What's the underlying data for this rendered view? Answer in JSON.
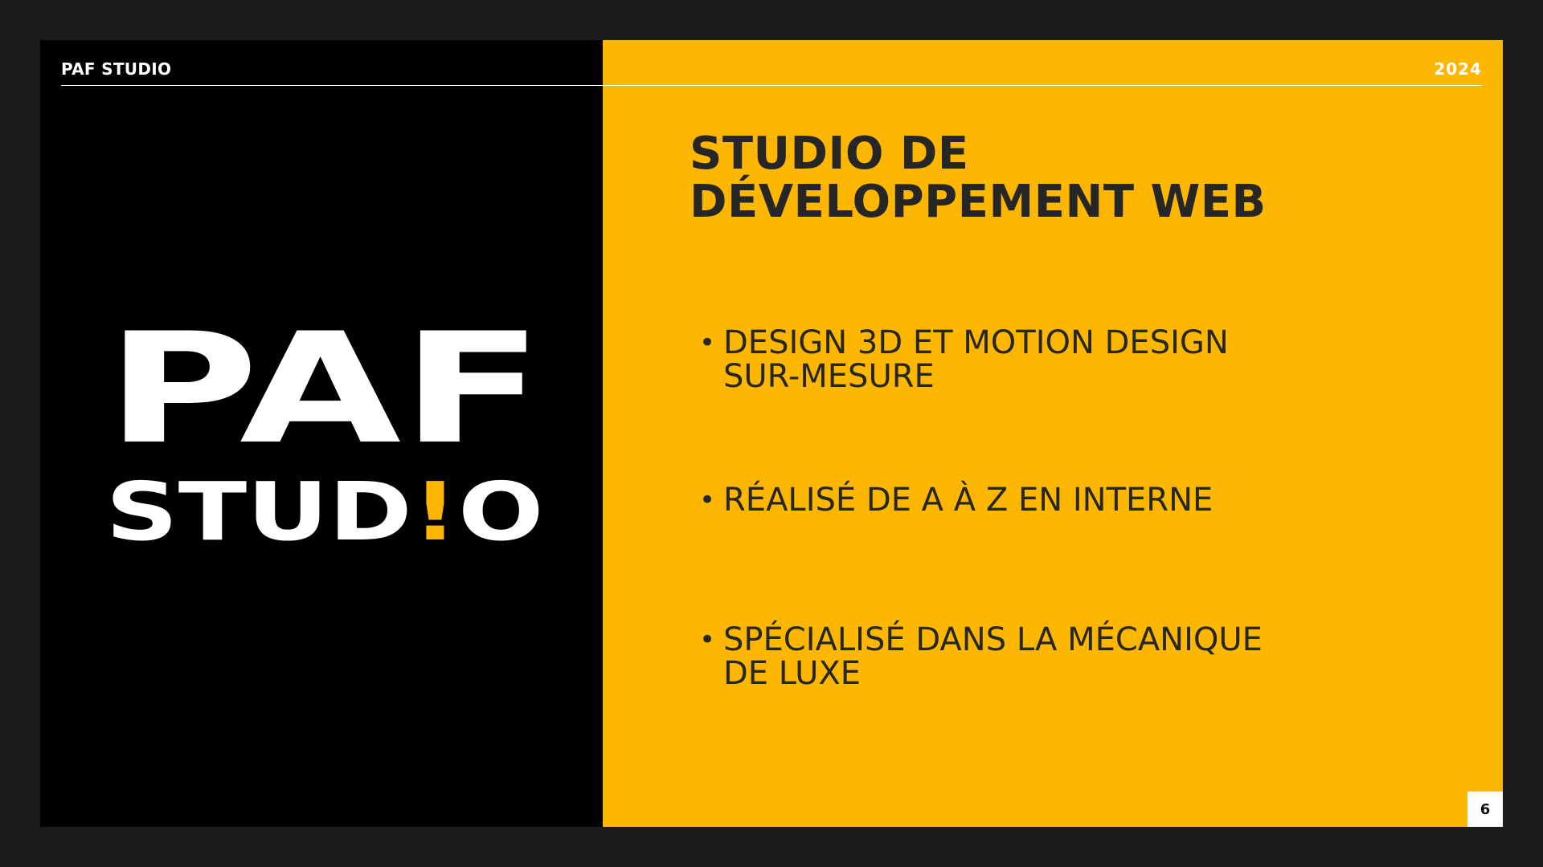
{
  "header": {
    "brand": "PAF STUDIO",
    "year": "2024"
  },
  "logo": {
    "line1": "PAF",
    "line2": "STUD!O",
    "accent_color": "#fdb700"
  },
  "content": {
    "title_lines": [
      "STUDIO DE",
      "DÉVELOPPEMENT WEB"
    ],
    "bullets": [
      {
        "lines": [
          "DESIGN 3D ET MOTION DESIGN",
          "SUR-MESURE"
        ]
      },
      {
        "lines": [
          "RÉALISÉ DE A À Z EN INTERNE"
        ]
      },
      {
        "lines": [
          "SPÉCIALISÉ DANS LA MÉCANIQUE",
          "DE LUXE"
        ]
      }
    ],
    "bullet_glyph": "•"
  },
  "footer": {
    "page_number": "6"
  },
  "colors": {
    "background": "#1c1c1e",
    "left_panel": "#000000",
    "right_panel": "#fdb700",
    "text_dark": "#262626",
    "text_light": "#ffffff"
  }
}
